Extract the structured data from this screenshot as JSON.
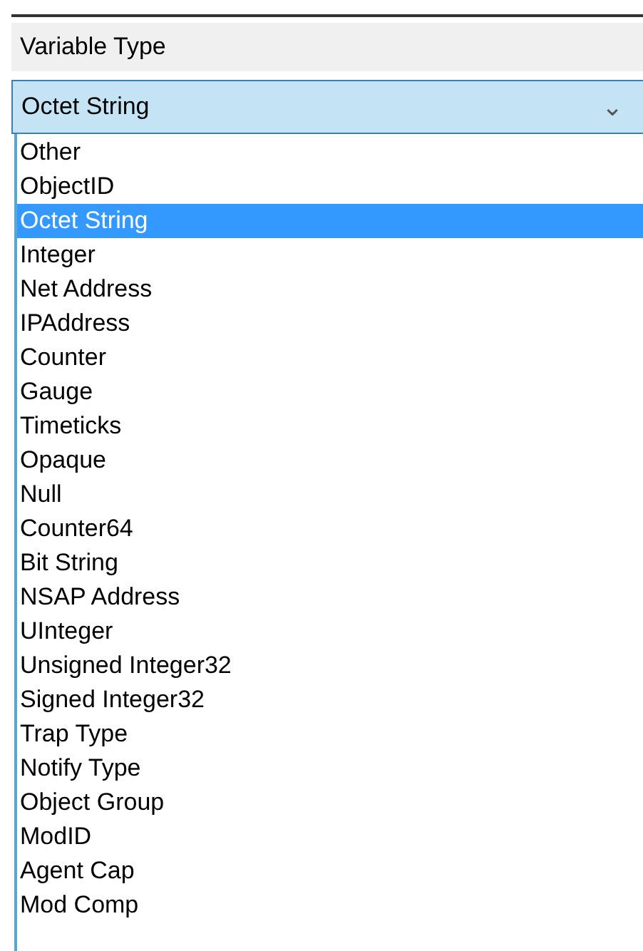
{
  "label": "Variable Type",
  "combo": {
    "value": "Octet String",
    "arrow": "⌄"
  },
  "options": [
    {
      "label": "Other",
      "selected": false
    },
    {
      "label": "ObjectID",
      "selected": false
    },
    {
      "label": "Octet String",
      "selected": true
    },
    {
      "label": "Integer",
      "selected": false
    },
    {
      "label": "Net Address",
      "selected": false
    },
    {
      "label": "IPAddress",
      "selected": false
    },
    {
      "label": "Counter",
      "selected": false
    },
    {
      "label": "Gauge",
      "selected": false
    },
    {
      "label": "Timeticks",
      "selected": false
    },
    {
      "label": "Opaque",
      "selected": false
    },
    {
      "label": "Null",
      "selected": false
    },
    {
      "label": "Counter64",
      "selected": false
    },
    {
      "label": "Bit String",
      "selected": false
    },
    {
      "label": "NSAP Address",
      "selected": false
    },
    {
      "label": "UInteger",
      "selected": false
    },
    {
      "label": "Unsigned Integer32",
      "selected": false
    },
    {
      "label": "Signed Integer32",
      "selected": false
    },
    {
      "label": "Trap Type",
      "selected": false
    },
    {
      "label": "Notify Type",
      "selected": false
    },
    {
      "label": "Object Group",
      "selected": false
    },
    {
      "label": "ModID",
      "selected": false
    },
    {
      "label": "Agent Cap",
      "selected": false
    },
    {
      "label": "Mod Comp",
      "selected": false
    }
  ]
}
